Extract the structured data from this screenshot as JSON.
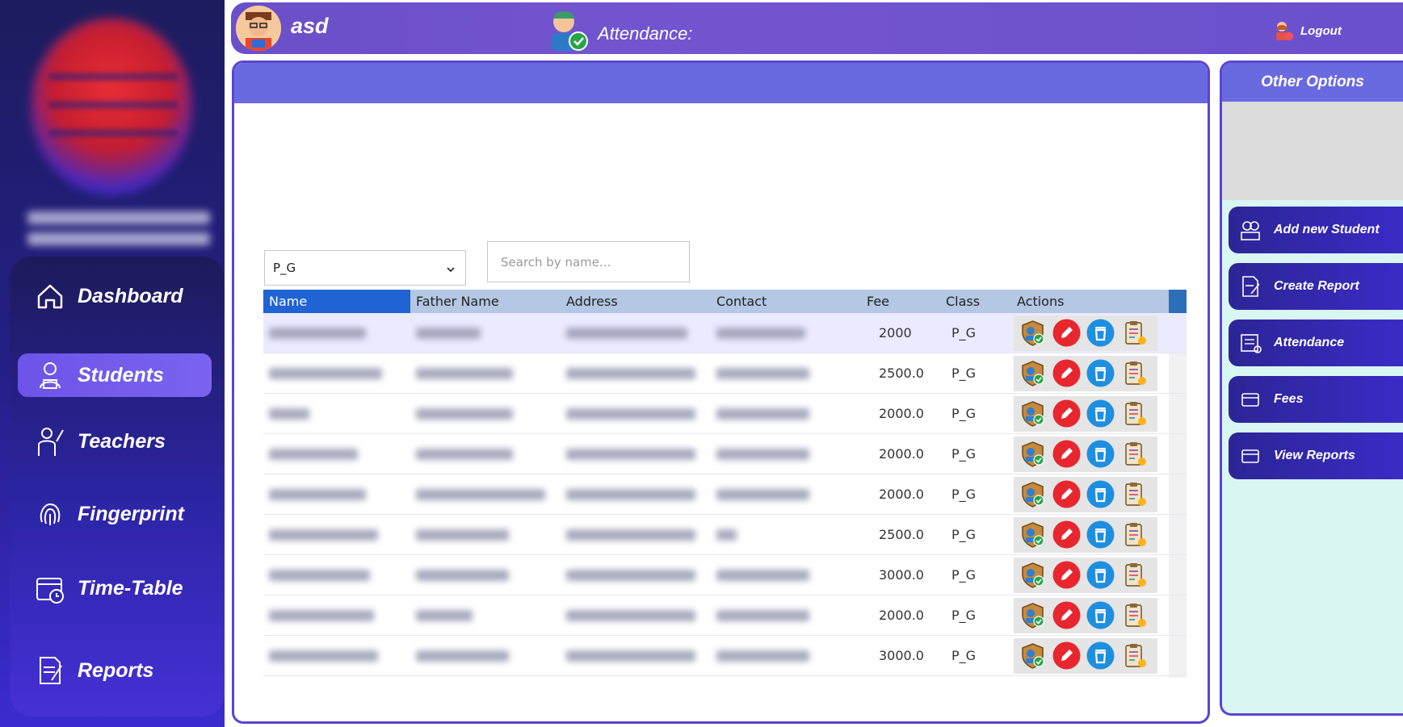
{
  "header": {
    "username": "asd",
    "attendance_label": "Attendance:",
    "logout_label": "Logout"
  },
  "sidebar": {
    "items": [
      {
        "label": "Dashboard",
        "icon": "home-icon"
      },
      {
        "label": "Students",
        "icon": "student-icon",
        "active": true
      },
      {
        "label": "Teachers",
        "icon": "teacher-icon"
      },
      {
        "label": "Fingerprint",
        "icon": "fingerprint-icon"
      },
      {
        "label": "Time-Table",
        "icon": "calendar-icon"
      },
      {
        "label": "Reports",
        "icon": "report-icon"
      }
    ]
  },
  "filter": {
    "selected_class": "P_G",
    "search_placeholder": "Search by name..."
  },
  "table": {
    "columns": [
      "Name",
      "Father Name",
      "Address",
      "Contact",
      "Fee",
      "Class",
      "Actions"
    ],
    "rows": [
      {
        "fee": "2000",
        "class": "P_G"
      },
      {
        "fee": "2500.0",
        "class": "P_G"
      },
      {
        "fee": "2000.0",
        "class": "P_G"
      },
      {
        "fee": "2000.0",
        "class": "P_G"
      },
      {
        "fee": "2000.0",
        "class": "P_G"
      },
      {
        "fee": "2500.0",
        "class": "P_G"
      },
      {
        "fee": "3000.0",
        "class": "P_G"
      },
      {
        "fee": "2000.0",
        "class": "P_G"
      },
      {
        "fee": "3000.0",
        "class": "P_G"
      }
    ],
    "row_actions": [
      "attendance-shield-icon",
      "edit-icon",
      "delete-icon",
      "clipboard-icon"
    ]
  },
  "options": {
    "title": "Other Options",
    "buttons": [
      {
        "label": "Add new Student",
        "icon": "add-student-icon"
      },
      {
        "label": "Create Report",
        "icon": "create-report-icon"
      },
      {
        "label": "Attendance",
        "icon": "attendance-icon"
      },
      {
        "label": "Fees",
        "icon": "fees-icon"
      },
      {
        "label": "View Reports",
        "icon": "view-reports-icon"
      }
    ]
  },
  "colors": {
    "sidebar_dark": "#1d1c5e",
    "sidebar_accent": "#3b2bd0",
    "header": "#6a4fc9",
    "panel_header": "#6a6ae0",
    "table_header": "#b4c7e4",
    "selected_header": "#1f63d4",
    "options_bg": "#d9f6f3",
    "edit_red": "#e8262e",
    "delete_blue": "#1e8fe0"
  }
}
